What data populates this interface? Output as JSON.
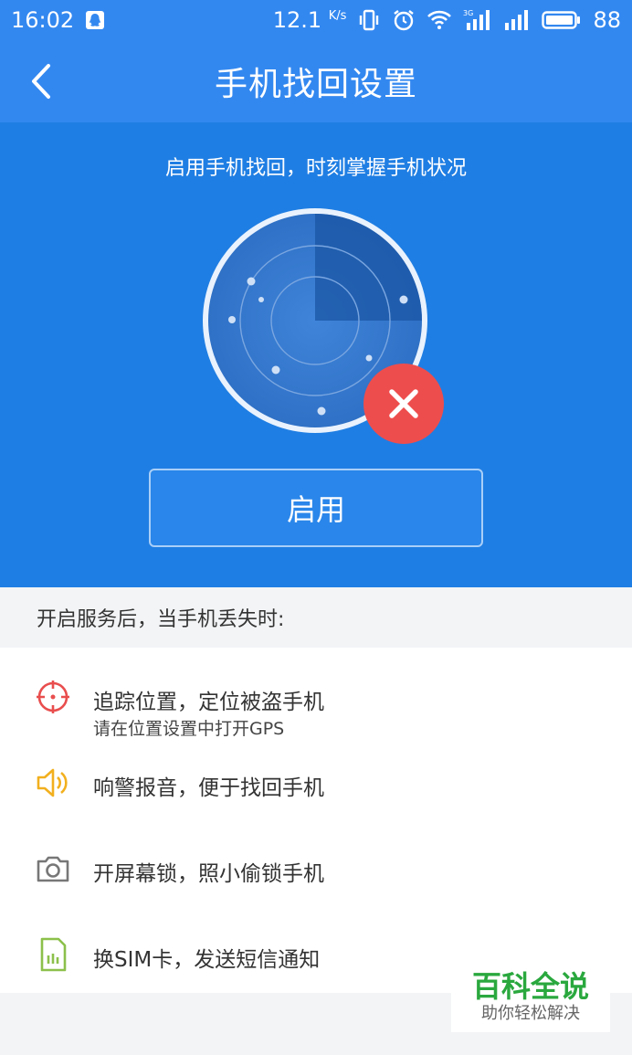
{
  "status_bar": {
    "time": "16:02",
    "net_speed": "12.1",
    "net_unit": "K/s",
    "signal_label": "3G",
    "battery": "88"
  },
  "header": {
    "title": "手机找回设置"
  },
  "hero": {
    "subtitle": "启用手机找回，时刻掌握手机状况",
    "enable_label": "启用",
    "status": "disabled"
  },
  "section": {
    "header": "开启服务后，当手机丢失时:"
  },
  "features": [
    {
      "icon": "crosshair-icon",
      "title": "追踪位置，定位被盗手机",
      "subtitle": "请在位置设置中打开GPS",
      "color": "#e94e4e"
    },
    {
      "icon": "speaker-icon",
      "title": "响警报音，便于找回手机",
      "color": "#f2b01e"
    },
    {
      "icon": "camera-icon",
      "title": "开屏幕锁，照小偷锁手机",
      "color": "#777777"
    },
    {
      "icon": "sim-card-icon",
      "title": "换SIM卡，发送短信通知",
      "color": "#8cc04b"
    }
  ],
  "watermark": {
    "title": "百科全说",
    "subtitle": "助你轻松解决"
  },
  "colors": {
    "primary": "#3388f0",
    "hero_bg": "#1f7ee3",
    "danger": "#ee4d4d"
  }
}
